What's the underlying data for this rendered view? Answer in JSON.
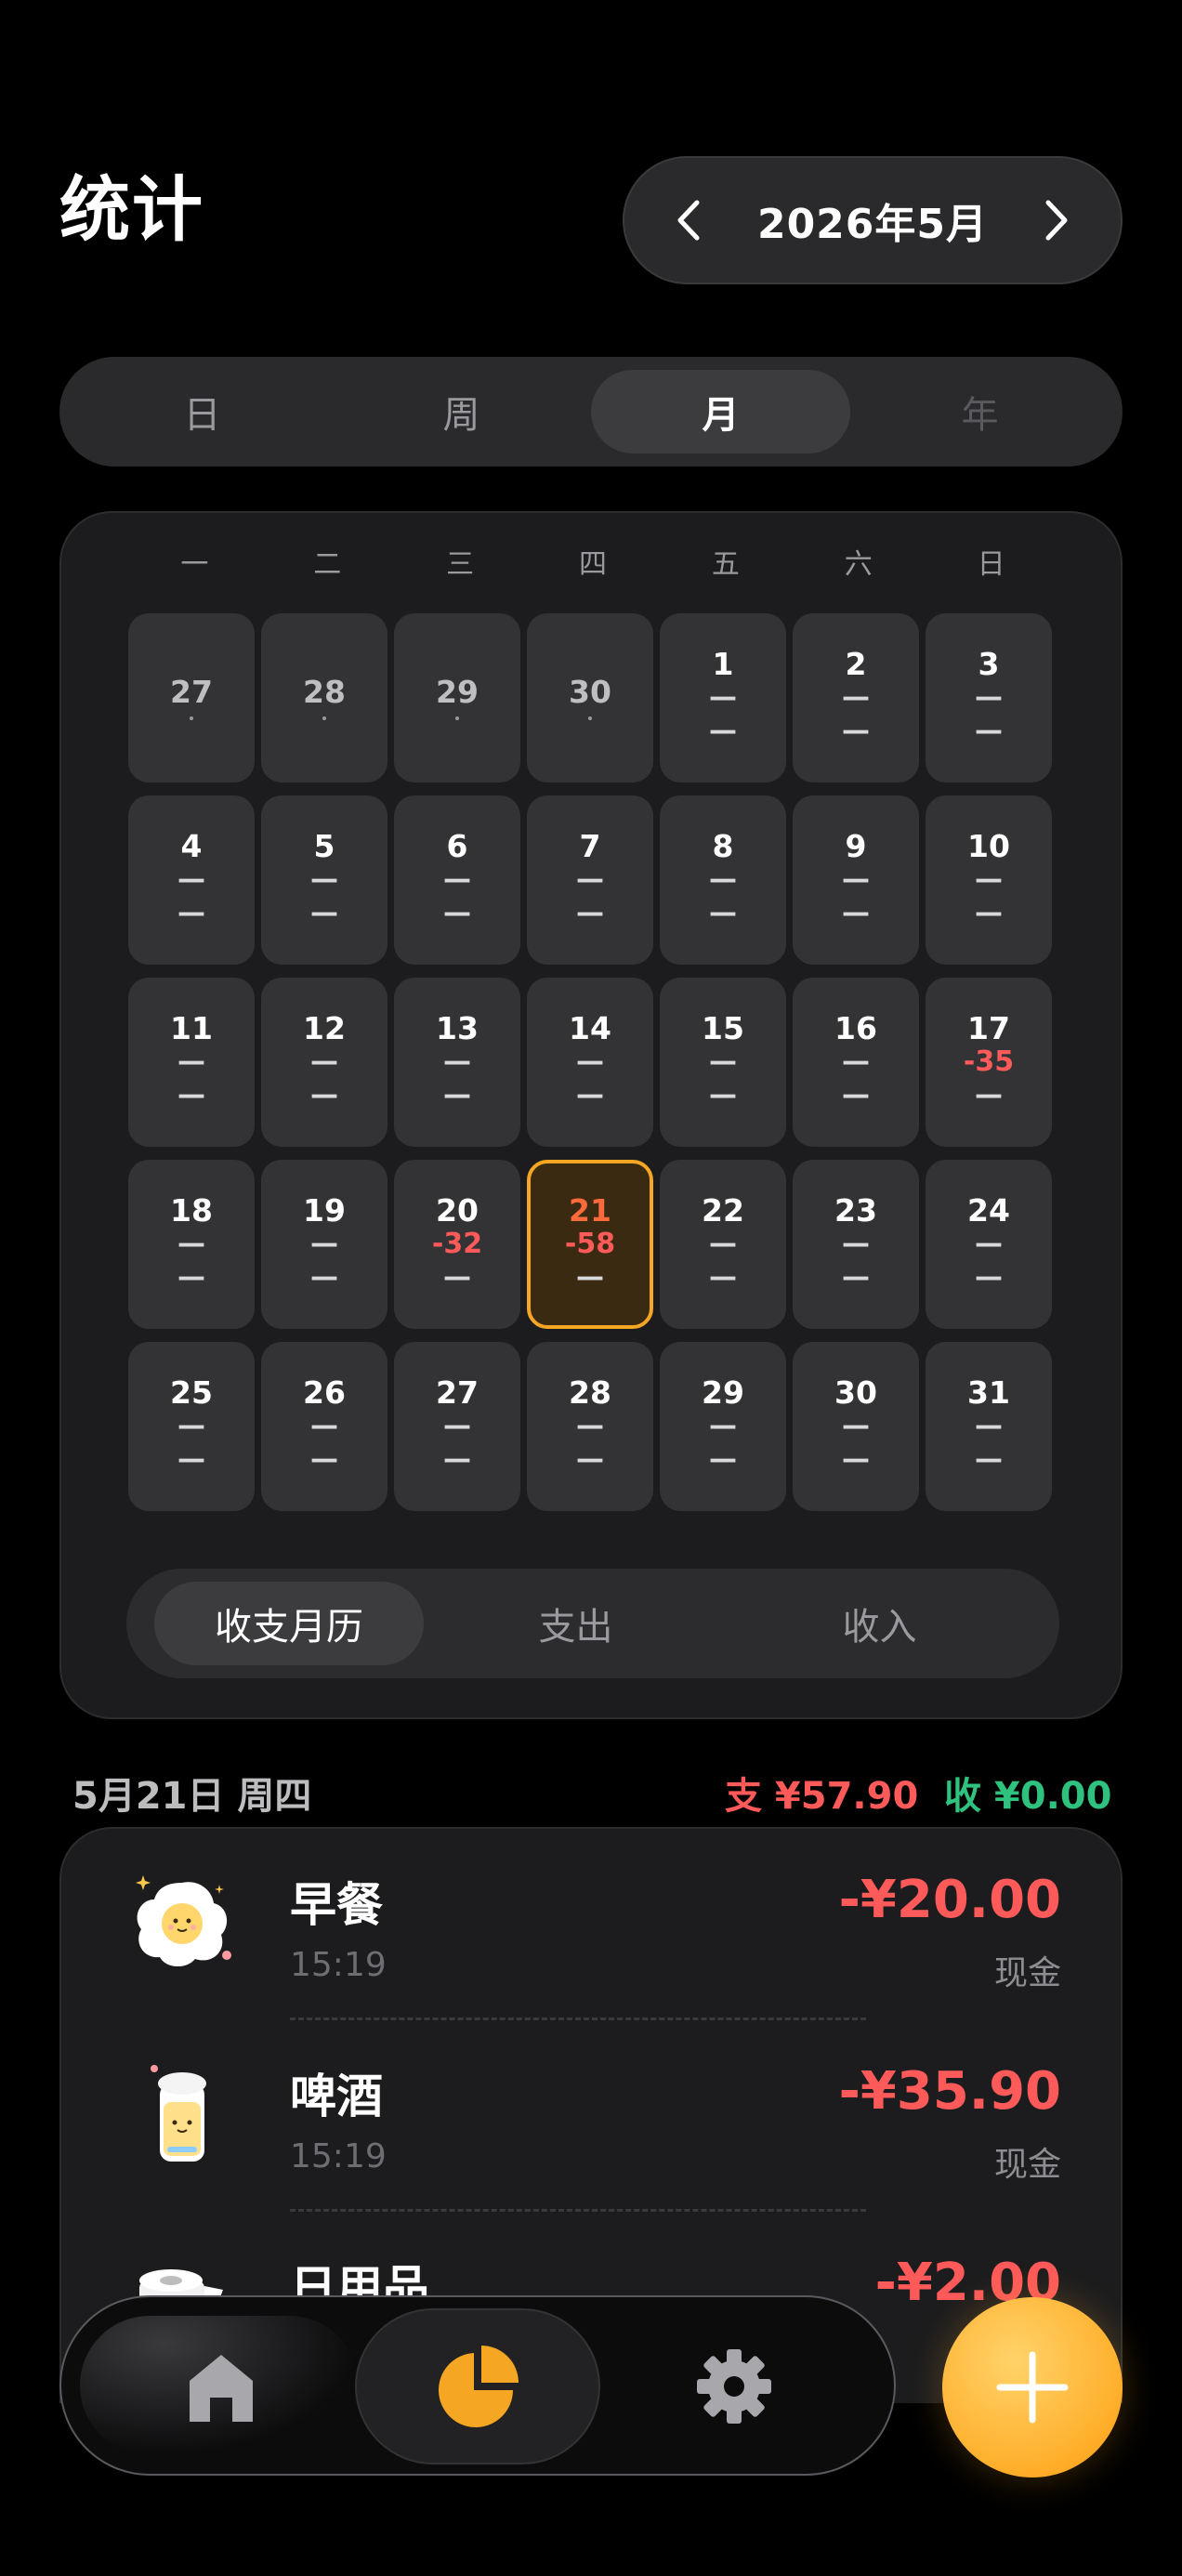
{
  "header": {
    "title": "统计",
    "month": "2026年5月"
  },
  "period_tabs": [
    {
      "label": "日",
      "state": "normal"
    },
    {
      "label": "周",
      "state": "normal"
    },
    {
      "label": "月",
      "state": "active"
    },
    {
      "label": "年",
      "state": "dim"
    }
  ],
  "calendar": {
    "weekdays": [
      "一",
      "二",
      "三",
      "四",
      "五",
      "六",
      "日"
    ],
    "cells": [
      {
        "day": "27",
        "other": true
      },
      {
        "day": "28",
        "other": true
      },
      {
        "day": "29",
        "other": true
      },
      {
        "day": "30",
        "other": true
      },
      {
        "day": "1",
        "exp": "—",
        "inc": "—"
      },
      {
        "day": "2",
        "exp": "—",
        "inc": "—"
      },
      {
        "day": "3",
        "exp": "—",
        "inc": "—"
      },
      {
        "day": "4",
        "exp": "—",
        "inc": "—"
      },
      {
        "day": "5",
        "exp": "—",
        "inc": "—"
      },
      {
        "day": "6",
        "exp": "—",
        "inc": "—"
      },
      {
        "day": "7",
        "exp": "—",
        "inc": "—"
      },
      {
        "day": "8",
        "exp": "—",
        "inc": "—"
      },
      {
        "day": "9",
        "exp": "—",
        "inc": "—"
      },
      {
        "day": "10",
        "exp": "—",
        "inc": "—"
      },
      {
        "day": "11",
        "exp": "—",
        "inc": "—"
      },
      {
        "day": "12",
        "exp": "—",
        "inc": "—"
      },
      {
        "day": "13",
        "exp": "—",
        "inc": "—"
      },
      {
        "day": "14",
        "exp": "—",
        "inc": "—"
      },
      {
        "day": "15",
        "exp": "—",
        "inc": "—"
      },
      {
        "day": "16",
        "exp": "—",
        "inc": "—"
      },
      {
        "day": "17",
        "exp": "-35",
        "inc": "—"
      },
      {
        "day": "18",
        "exp": "—",
        "inc": "—"
      },
      {
        "day": "19",
        "exp": "—",
        "inc": "—"
      },
      {
        "day": "20",
        "exp": "-32",
        "inc": "—"
      },
      {
        "day": "21",
        "exp": "-58",
        "inc": "—",
        "today": true
      },
      {
        "day": "22",
        "exp": "—",
        "inc": "—"
      },
      {
        "day": "23",
        "exp": "—",
        "inc": "—"
      },
      {
        "day": "24",
        "exp": "—",
        "inc": "—"
      },
      {
        "day": "25",
        "exp": "—",
        "inc": "—"
      },
      {
        "day": "26",
        "exp": "—",
        "inc": "—"
      },
      {
        "day": "27",
        "exp": "—",
        "inc": "—"
      },
      {
        "day": "28",
        "exp": "—",
        "inc": "—"
      },
      {
        "day": "29",
        "exp": "—",
        "inc": "—"
      },
      {
        "day": "30",
        "exp": "—",
        "inc": "—"
      },
      {
        "day": "31",
        "exp": "—",
        "inc": "—"
      }
    ],
    "modes": [
      "收支月历",
      "支出",
      "收入"
    ]
  },
  "day_summary": {
    "title": "5月21日 周四",
    "expense": "支 ¥57.90",
    "income": "收 ¥0.00"
  },
  "transactions": [
    {
      "name": "早餐",
      "time": "15:19",
      "amount": "-¥20.00",
      "account": "现金",
      "icon": "fried-egg-icon"
    },
    {
      "name": "啤酒",
      "time": "15:19",
      "amount": "-¥35.90",
      "account": "现金",
      "icon": "beer-can-icon"
    },
    {
      "name": "日用品",
      "time": "",
      "amount": "-¥2.00",
      "account": "",
      "icon": "toilet-paper-icon"
    }
  ],
  "nav": {
    "items": [
      "home-icon",
      "pie-chart-icon",
      "gear-icon"
    ],
    "active": "pie-chart-icon"
  },
  "colors": {
    "accent": "#f5a623",
    "expense": "#ff5a5a",
    "income": "#2ec27e"
  }
}
